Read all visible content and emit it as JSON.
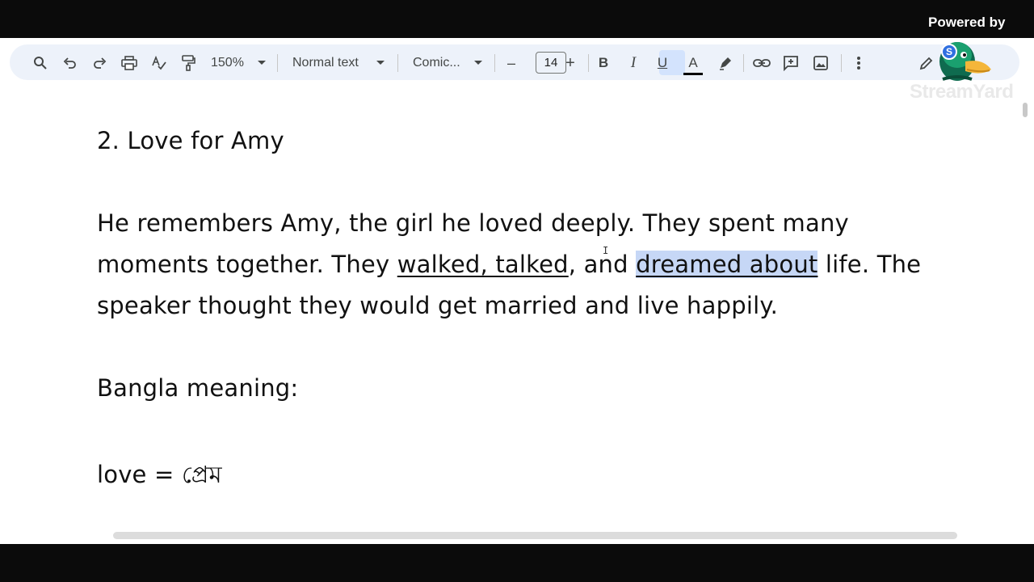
{
  "overlay": {
    "powered_by": "Powered by",
    "watermark": "StreamYard",
    "logo_icon": "duck-mascot-logo-icon"
  },
  "toolbar": {
    "icons": [
      "search-icon",
      "undo-icon",
      "redo-icon",
      "print-icon",
      "spellcheck-icon",
      "paint-format-icon",
      "link-icon",
      "add-comment-icon",
      "insert-image-icon",
      "more-options-icon",
      "edit-mode-pencil-icon",
      "highlighter-icon"
    ],
    "zoom": "150%",
    "style": "Normal text",
    "font": "Comic...",
    "decrease": "–",
    "font_size": "14",
    "increase": "+",
    "bold": "B",
    "italic": "I",
    "underline": "U",
    "text_color": "A",
    "text_color_value": "#000000",
    "active_format": "underline",
    "highlight_color": "#c6d7f6"
  },
  "document": {
    "heading": "2. Love for Amy",
    "paragraph": {
      "line1": "He remembers Amy, the girl he loved deeply. They spent many",
      "line2_a": "moments together. They ",
      "line2_u1": "walked, talked",
      "line2_b": ", and ",
      "line2_hl": "dreamed about",
      "line2_c": " life. The",
      "line3": "speaker thought they would get married and live happily."
    },
    "meaning_label": "Bangla meaning:",
    "vocab": "love = প্রেম"
  }
}
